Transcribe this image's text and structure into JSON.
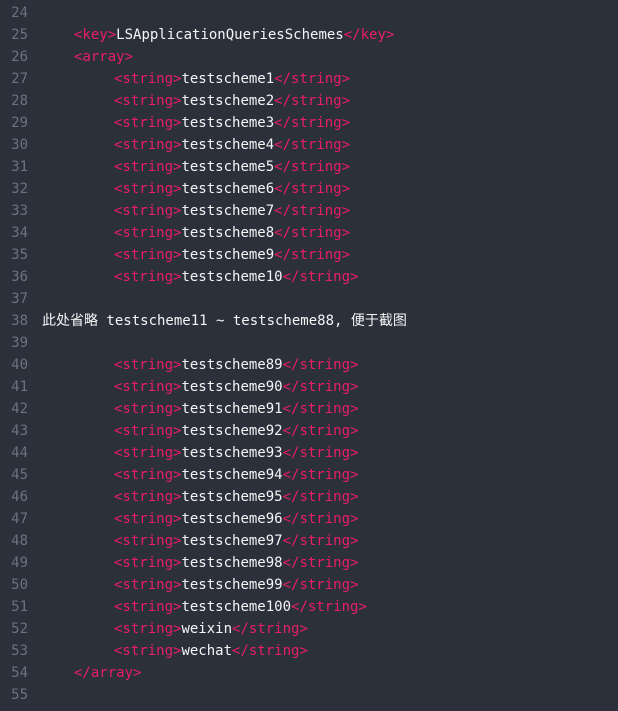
{
  "lineNumbers": [
    "24",
    "25",
    "26",
    "27",
    "28",
    "29",
    "30",
    "31",
    "32",
    "33",
    "34",
    "35",
    "36",
    "37",
    "38",
    "39",
    "40",
    "41",
    "42",
    "43",
    "44",
    "45",
    "46",
    "47",
    "48",
    "49",
    "50",
    "51",
    "52",
    "53",
    "54",
    "55"
  ],
  "keyTag": "key",
  "keyValue": "LSApplicationQueriesSchemes",
  "arrayTag": "array",
  "stringTag": "string",
  "schemesTop": [
    "testscheme1",
    "testscheme2",
    "testscheme3",
    "testscheme4",
    "testscheme5",
    "testscheme6",
    "testscheme7",
    "testscheme8",
    "testscheme9",
    "testscheme10"
  ],
  "commentText": "此处省略 testscheme11 ~ testscheme88, 便于截图",
  "schemesBottom": [
    "testscheme89",
    "testscheme90",
    "testscheme91",
    "testscheme92",
    "testscheme93",
    "testscheme94",
    "testscheme95",
    "testscheme96",
    "testscheme97",
    "testscheme98",
    "testscheme99",
    "testscheme100",
    "weixin",
    "wechat"
  ]
}
